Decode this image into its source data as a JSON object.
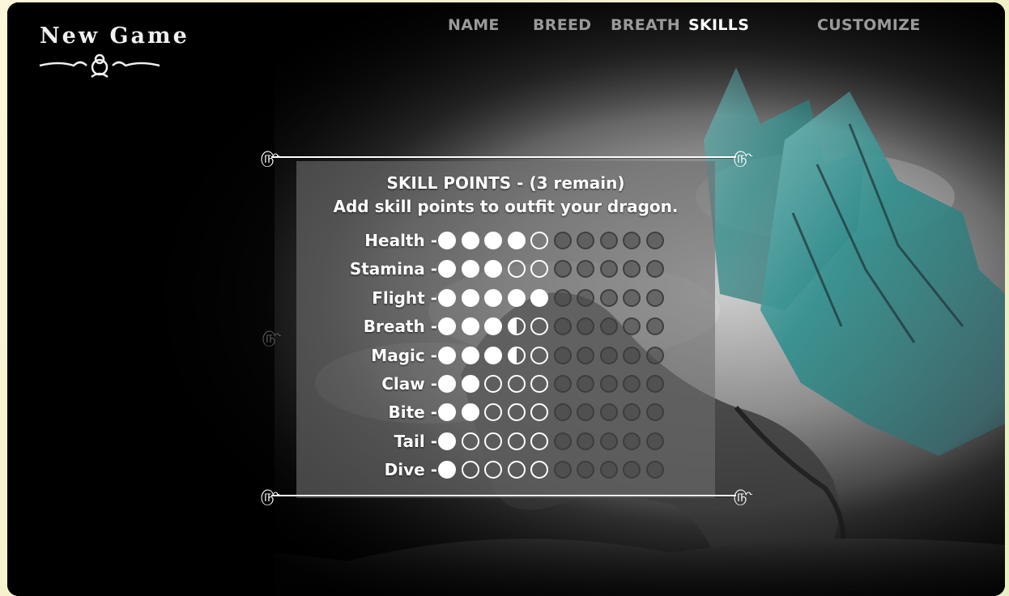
{
  "header": {
    "logo_text": "New Game"
  },
  "nav": {
    "tabs": [
      {
        "label": "NAME",
        "active": false
      },
      {
        "label": "BREED",
        "active": false
      },
      {
        "label": "BREATH",
        "active": false
      },
      {
        "label": "SKILLS",
        "active": true
      },
      {
        "label": "CUSTOMIZE",
        "active": false
      }
    ]
  },
  "panel": {
    "title": "SKILL POINTS - (3 remain)",
    "subtitle": "Add skill points to outfit your dragon.",
    "ornament": "௹§",
    "skills": [
      {
        "label": "Health -",
        "pips": [
          "full",
          "full",
          "full",
          "full",
          "empty"
        ]
      },
      {
        "label": "Stamina -",
        "pips": [
          "full",
          "full",
          "full",
          "empty",
          "empty"
        ]
      },
      {
        "label": "Flight -",
        "pips": [
          "full",
          "full",
          "full",
          "full",
          "full"
        ]
      },
      {
        "label": "Breath -",
        "pips": [
          "full",
          "full",
          "full",
          "half",
          "empty"
        ]
      },
      {
        "label": "Magic -",
        "pips": [
          "full",
          "full",
          "full",
          "half",
          "empty"
        ]
      },
      {
        "label": "Claw -",
        "pips": [
          "full",
          "full",
          "empty",
          "empty",
          "empty"
        ]
      },
      {
        "label": "Bite -",
        "pips": [
          "full",
          "full",
          "empty",
          "empty",
          "empty"
        ]
      },
      {
        "label": "Tail -",
        "pips": [
          "full",
          "empty",
          "empty",
          "empty",
          "empty"
        ]
      },
      {
        "label": "Dive -",
        "pips": [
          "full",
          "empty",
          "empty",
          "empty",
          "empty"
        ]
      }
    ],
    "locked_pips_per_row": 5
  },
  "colors": {
    "active_tab": "#ffffff",
    "inactive_tab": "#9a9a9a",
    "panel_bg": "rgba(110,110,110,0.62)",
    "wing_teal": "#3f9a98"
  }
}
